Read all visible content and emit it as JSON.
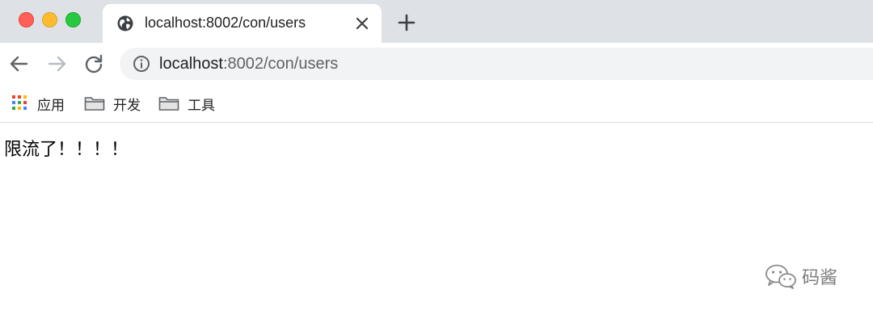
{
  "window": {
    "traffic_lights": [
      "close",
      "minimize",
      "maximize"
    ]
  },
  "tab": {
    "title": "localhost:8002/con/users",
    "icon": "globe-icon"
  },
  "toolbar": {
    "back_icon": "arrow-left-icon",
    "forward_icon": "arrow-right-icon",
    "reload_icon": "reload-icon",
    "url_host": "localhost",
    "url_rest": ":8002/con/users"
  },
  "bookmarks": {
    "items": [
      {
        "label": "应用",
        "icon": "apps-grid-icon"
      },
      {
        "label": "开发",
        "icon": "folder-icon"
      },
      {
        "label": "工具",
        "icon": "folder-icon"
      }
    ]
  },
  "page": {
    "message": "限流了！！！！"
  },
  "watermark": {
    "text": "码酱"
  }
}
